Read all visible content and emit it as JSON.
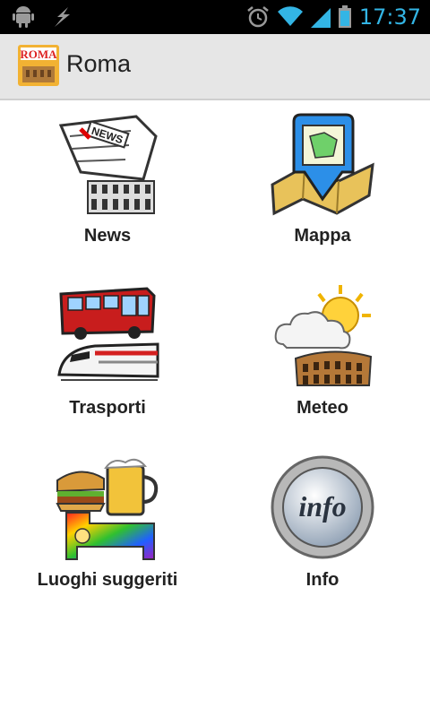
{
  "status_bar": {
    "time": "17:37",
    "icons": [
      "android-icon",
      "usb-debug-icon",
      "alarm-icon",
      "wifi-icon",
      "signal-icon",
      "battery-icon"
    ]
  },
  "action_bar": {
    "title": "Roma",
    "app_icon_text": "ROMA"
  },
  "menu": [
    {
      "label": "News",
      "icon": "news-icon"
    },
    {
      "label": "Mappa",
      "icon": "map-icon"
    },
    {
      "label": "Trasporti",
      "icon": "transport-icon"
    },
    {
      "label": "Meteo",
      "icon": "weather-icon"
    },
    {
      "label": "Luoghi suggeriti",
      "icon": "places-icon"
    },
    {
      "label": "Info",
      "icon": "info-icon"
    }
  ],
  "colors": {
    "status_clock": "#33b5e5",
    "action_bar": "#e6e6e6"
  }
}
